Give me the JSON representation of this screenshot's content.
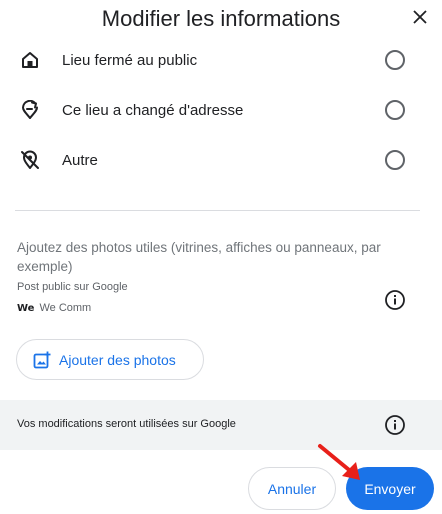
{
  "dialog": {
    "title": "Modifier les informations",
    "close_icon": "close-icon"
  },
  "options": [
    {
      "label": "Lieu fermé au public",
      "icon": "store-closed-icon",
      "selected": false
    },
    {
      "label": "Ce lieu a changé d'adresse",
      "icon": "moved-location-icon",
      "selected": false
    },
    {
      "label": "Autre",
      "icon": "location-off-icon",
      "selected": false
    }
  ],
  "photos": {
    "description": "Ajoutez des photos utiles (vitrines, affiches ou panneaux, par exemple)",
    "post_public": "Post public sur Google",
    "account_logo": "We",
    "account_name": "We Comm",
    "add_button_label": "Ajouter des photos"
  },
  "notice": {
    "text": "Vos modifications seront utilisées sur Google"
  },
  "actions": {
    "cancel_label": "Annuler",
    "send_label": "Envoyer"
  },
  "colors": {
    "accent": "#1a73e8",
    "annotation_arrow": "#e8201a"
  }
}
